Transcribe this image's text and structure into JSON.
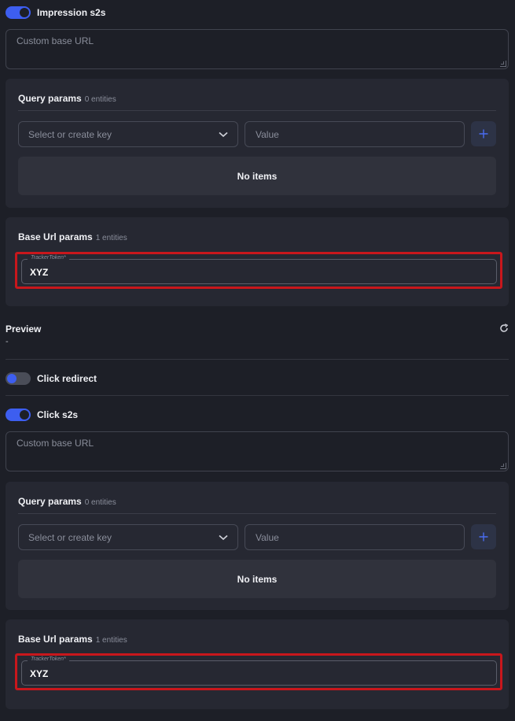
{
  "sections": {
    "impression_s2s": {
      "label": "Impression s2s",
      "enabled": true
    },
    "click_redirect": {
      "label": "Click redirect",
      "enabled": false
    },
    "click_s2s": {
      "label": "Click s2s",
      "enabled": true
    }
  },
  "impression": {
    "base_url_placeholder": "Custom base URL",
    "query_params": {
      "title": "Query params",
      "count": "0 entities",
      "key_placeholder": "Select or create key",
      "value_placeholder": "Value",
      "empty_text": "No items"
    },
    "base_url_params": {
      "title": "Base Url params",
      "count": "1 entities",
      "field_label": "TrackerToken*",
      "field_value": "XYZ"
    }
  },
  "preview": {
    "label": "Preview",
    "value": "-"
  },
  "click": {
    "base_url_placeholder": "Custom base URL",
    "query_params": {
      "title": "Query params",
      "count": "0 entities",
      "key_placeholder": "Select or create key",
      "value_placeholder": "Value",
      "empty_text": "No items"
    },
    "base_url_params": {
      "title": "Base Url params",
      "count": "1 entities",
      "field_label": "TrackerToken*",
      "field_value": "XYZ"
    }
  },
  "colors": {
    "accent": "#3d5ef0",
    "highlight": "#c8171c",
    "background": "#1d1f27",
    "card": "#262832"
  },
  "icons": {
    "add": "plus-icon",
    "dropdown": "chevron-down-icon",
    "refresh": "refresh-icon"
  }
}
